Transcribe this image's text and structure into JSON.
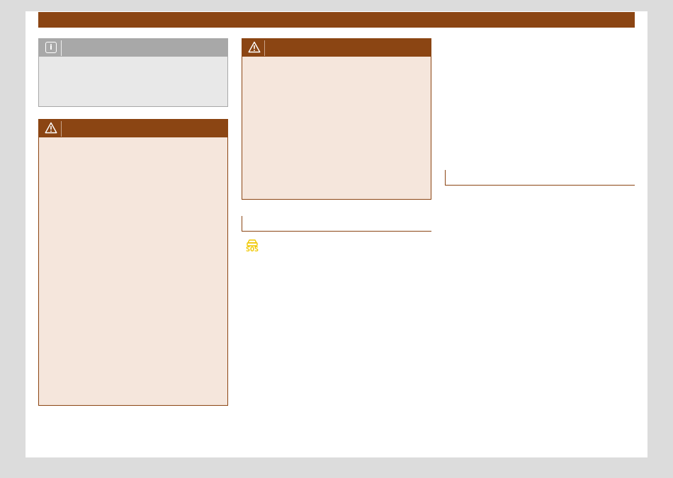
{
  "icons": {
    "info": "info-icon",
    "warning": "warning-triangle-icon",
    "sos": "sos-vehicle-icon"
  },
  "sos_icon_label": "SOS",
  "colors": {
    "accent": "#8b4513",
    "warning_fill": "#f5e6dc",
    "note_header": "#a8a8a8",
    "note_fill": "#e8e8e8",
    "sos_yellow": "#f0c800"
  }
}
